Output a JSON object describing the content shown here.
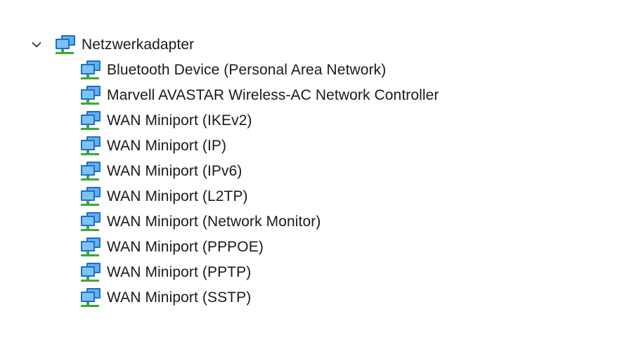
{
  "tree": {
    "category": {
      "label": "Netzwerkadapter",
      "expanded": true,
      "icon": "network-adapter-icon"
    },
    "devices": [
      {
        "label": "Bluetooth Device (Personal Area Network)",
        "icon": "network-adapter-icon"
      },
      {
        "label": "Marvell AVASTAR Wireless-AC Network Controller",
        "icon": "network-adapter-icon"
      },
      {
        "label": "WAN Miniport (IKEv2)",
        "icon": "network-adapter-icon"
      },
      {
        "label": "WAN Miniport (IP)",
        "icon": "network-adapter-icon"
      },
      {
        "label": "WAN Miniport (IPv6)",
        "icon": "network-adapter-icon"
      },
      {
        "label": "WAN Miniport (L2TP)",
        "icon": "network-adapter-icon"
      },
      {
        "label": "WAN Miniport (Network Monitor)",
        "icon": "network-adapter-icon"
      },
      {
        "label": "WAN Miniport (PPPOE)",
        "icon": "network-adapter-icon"
      },
      {
        "label": "WAN Miniport (PPTP)",
        "icon": "network-adapter-icon"
      },
      {
        "label": "WAN Miniport (SSTP)",
        "icon": "network-adapter-icon"
      }
    ]
  },
  "colors": {
    "monitor_frame": "#1f6fc6",
    "monitor_screen": "#5fb0f2",
    "connector": "#3aa935",
    "chevron": "#333333"
  }
}
